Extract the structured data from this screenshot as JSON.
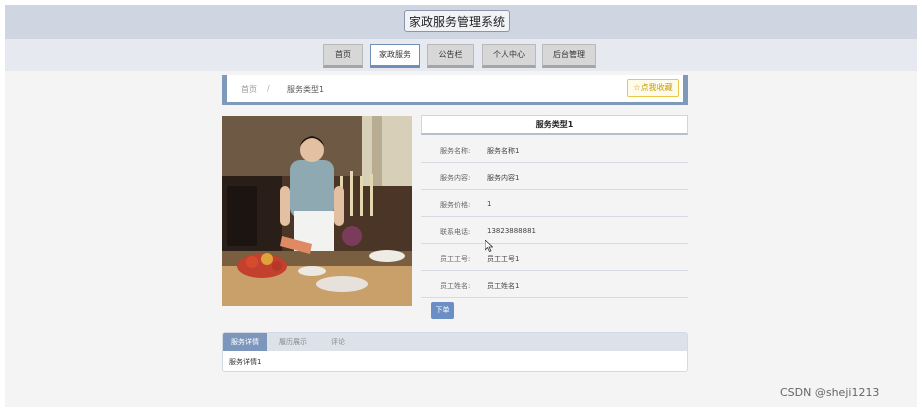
{
  "header": {
    "title": "家政服务管理系统"
  },
  "nav": {
    "items": [
      {
        "label": "首页",
        "active": false
      },
      {
        "label": "家政服务",
        "active": true
      },
      {
        "label": "公告栏",
        "active": false
      },
      {
        "label": "个人中心",
        "active": false
      },
      {
        "label": "后台管理",
        "active": false
      }
    ]
  },
  "breadcrumb": {
    "home": "首页",
    "separator": "/",
    "current": "服务类型1",
    "favorite": "☆点我收藏"
  },
  "detail": {
    "title": "服务类型1",
    "rows": [
      {
        "label": "服务名称:",
        "value": "服务名称1"
      },
      {
        "label": "服务内容:",
        "value": "服务内容1"
      },
      {
        "label": "服务价格:",
        "value": "1"
      },
      {
        "label": "联系电话:",
        "value": "13823888881"
      },
      {
        "label": "员工工号:",
        "value": "员工工号1"
      },
      {
        "label": "员工姓名:",
        "value": "员工姓名1"
      }
    ],
    "order_button": "下单"
  },
  "tabs": {
    "items": [
      {
        "label": "服务详情",
        "active": true
      },
      {
        "label": "履历展示",
        "active": false
      },
      {
        "label": "评论",
        "active": false
      }
    ],
    "content": "服务详情1"
  },
  "watermark": "CSDN @sheji1213",
  "colors": {
    "accent": "#7f99bb",
    "button": "#6b8fc4",
    "favorite": "#e9c84a"
  }
}
